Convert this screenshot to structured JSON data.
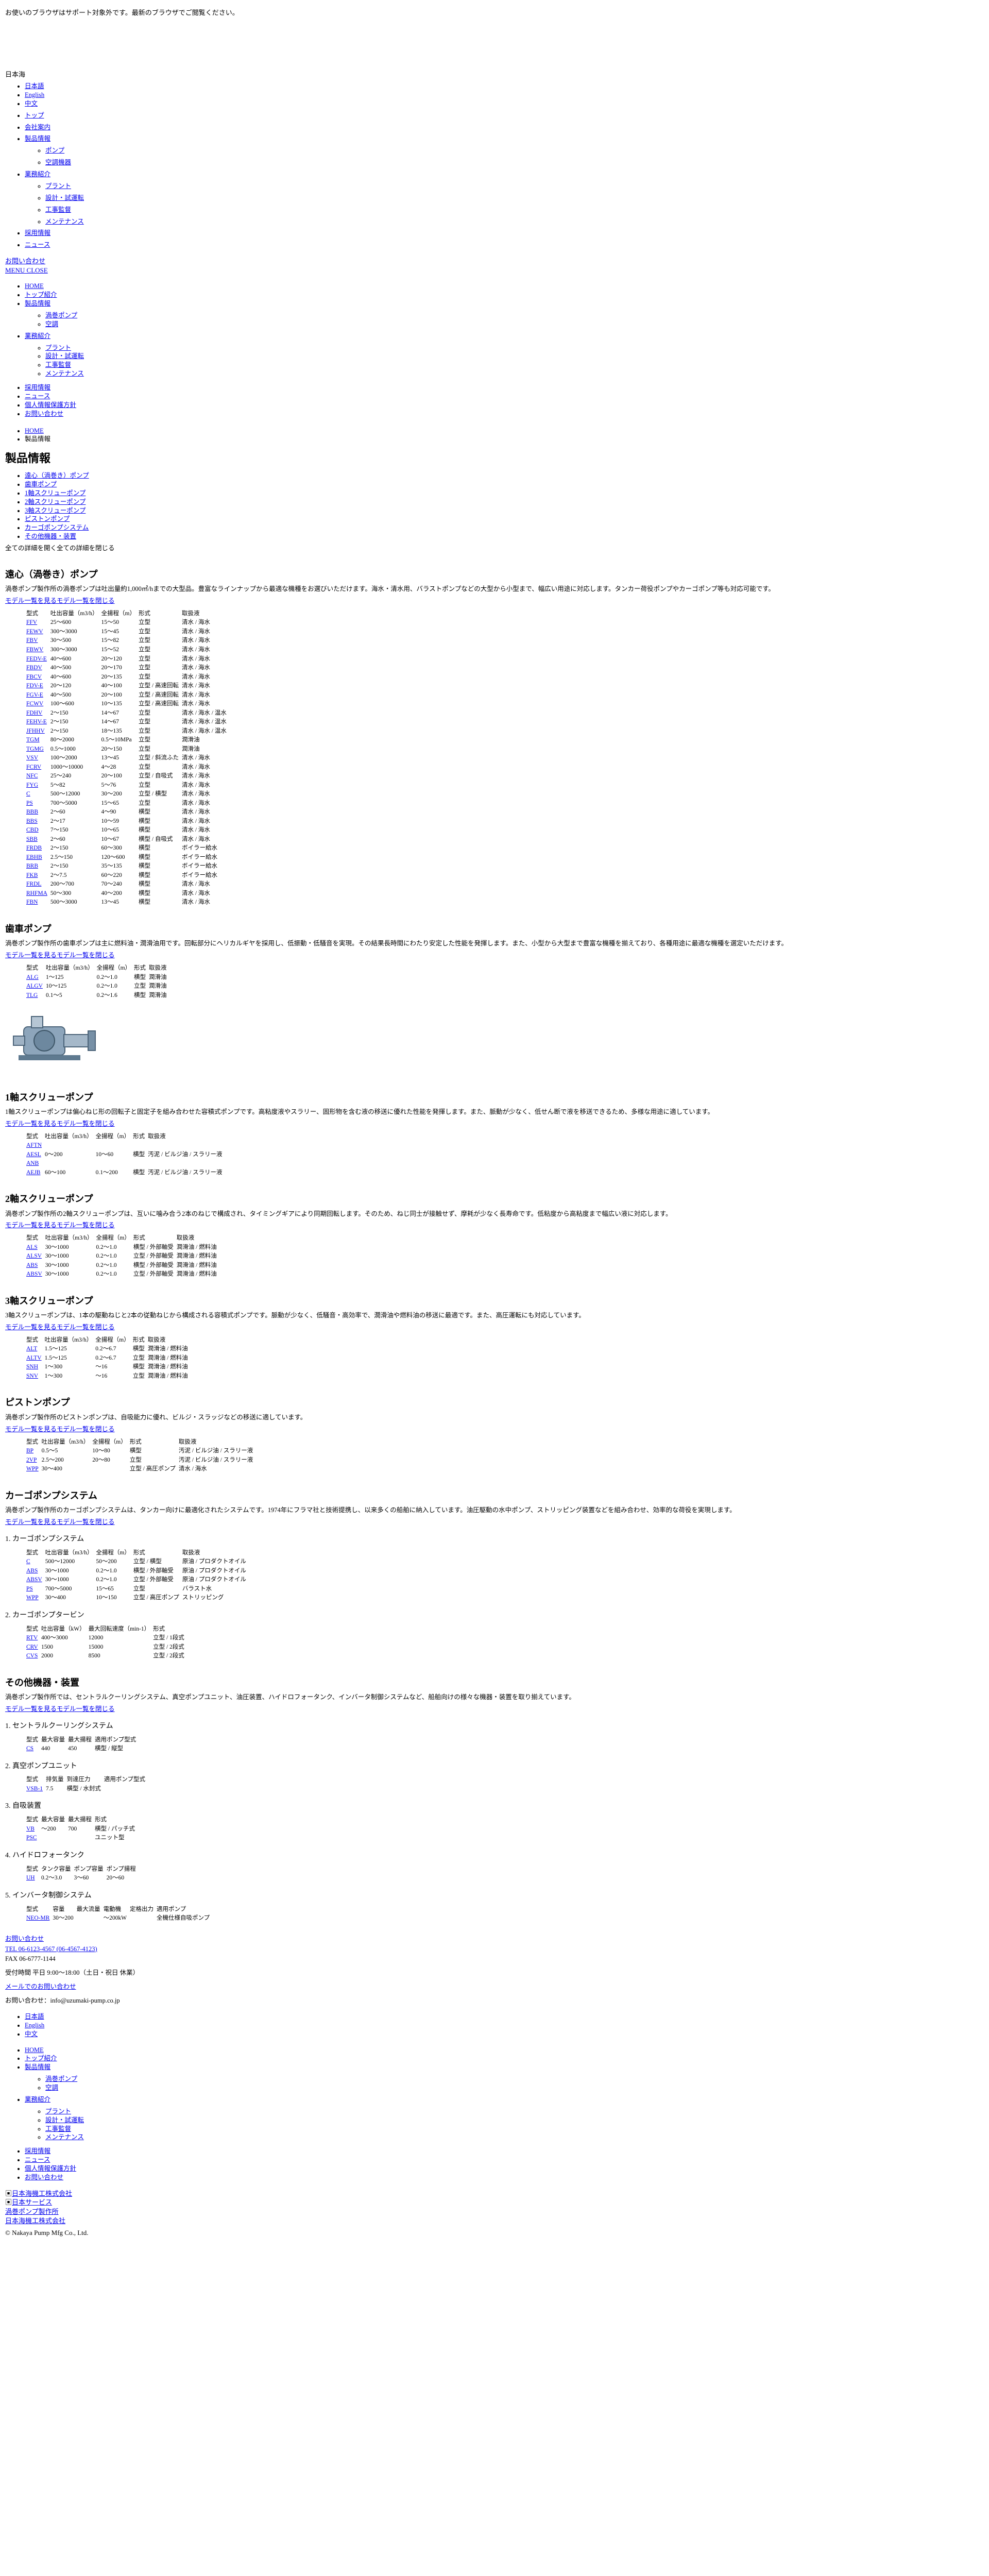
{
  "notice": "お使いのブラウザはサポート対象外です。最新のブラウザでご閲覧ください。",
  "logo": "日本海",
  "lang_links": [
    "日本語",
    "English",
    "中文"
  ],
  "main_nav": [
    "トップ",
    "会社案内",
    "製品情報"
  ],
  "products_sub1": [
    "ポンプ",
    "空調機器"
  ],
  "main_nav_more": "業務紹介",
  "works_sub": [
    "プラント",
    "設計・試運転",
    "工事監督",
    "メンテナンス"
  ],
  "main_nav_tail": [
    "採用情報",
    "ニュース"
  ],
  "contact_link": "お問い合わせ",
  "menu_close": "MENU CLOSE",
  "nav2": [
    "HOME",
    "トップ紹介",
    "製品情報"
  ],
  "nav2_products": [
    "渦巻ポンプ",
    "空調"
  ],
  "nav2_works": "業務紹介",
  "nav2_works_sub": [
    "プラント",
    "設計・試運転",
    "工事監督",
    "メンテナンス"
  ],
  "nav2_tail": [
    "採用情報",
    "ニュース",
    "個人情報保護方針",
    "お問い合わせ"
  ],
  "breadcrumb": [
    "HOME",
    "製品情報"
  ],
  "page_title": "製品情報",
  "anchors": [
    "遠心（渦巻き）ポンプ",
    "歯車ポンプ",
    "1軸スクリューポンプ",
    "2軸スクリューポンプ",
    "3軸スクリューポンプ",
    "ピストンポンプ",
    "カーゴポンプシステム",
    "その他機器・装置"
  ],
  "open_all": "全ての詳細を開く全ての詳細を閉じる",
  "model_link": "モデル一覧を見るモデル一覧を閉じる",
  "sections": {
    "centrifugal": {
      "title": "遠心（渦巻き）ポンプ",
      "desc": "渦巻ポンプ製作所の渦巻ポンプは吐出量約1,000㎥/hまでの大型品。豊富なラインナップから最適な機種をお選びいただけます。海水・清水用、バラストポンプなどの大型から小型まで、幅広い用途に対応します。タンカー荷役ポンプやカーゴポンプ等も対応可能です。",
      "headers": [
        "型式",
        "吐出容量（m3/h）",
        "全揚程（m）",
        "形式",
        "取扱液"
      ],
      "rows": [
        [
          "FFV",
          "25～600",
          "15～50",
          "立型",
          "清水 / 海水"
        ],
        [
          "FEWV",
          "300～3000",
          "15～45",
          "立型",
          "清水 / 海水"
        ],
        [
          "FBV",
          "30～500",
          "15～82",
          "立型",
          "清水 / 海水"
        ],
        [
          "FBWV",
          "300～3000",
          "15～52",
          "立型",
          "清水 / 海水"
        ],
        [
          "FEDV-E",
          "40～600",
          "20～120",
          "立型",
          "清水 / 海水"
        ],
        [
          "FBDV",
          "40～500",
          "20～170",
          "立型",
          "清水 / 海水"
        ],
        [
          "FBCV",
          "40～600",
          "20～135",
          "立型",
          "清水 / 海水"
        ],
        [
          "FDV-E",
          "20～120",
          "40～100",
          "立型 / 高速回転",
          "清水 / 海水"
        ],
        [
          "FGV-E",
          "40～500",
          "20～100",
          "立型 / 高速回転",
          "清水 / 海水"
        ],
        [
          "FCWV",
          "100～600",
          "10～135",
          "立型 / 高速回転",
          "清水 / 海水"
        ],
        [
          "FDHV",
          "2～150",
          "14～67",
          "立型",
          "清水 / 海水 / 温水"
        ],
        [
          "FEHV-E",
          "2～150",
          "14～67",
          "立型",
          "清水 / 海水 / 温水"
        ],
        [
          "JFHHV",
          "2～150",
          "18～135",
          "立型",
          "清水 / 海水 / 温水"
        ],
        [
          "TGM",
          "80～2000",
          "0.5～10MPa",
          "立型",
          "潤滑油"
        ],
        [
          "TGMG",
          "0.5～1000",
          "20～150",
          "立型",
          "潤滑油"
        ],
        [
          "VSV",
          "100～2000",
          "13～45",
          "立型 / 斜流ふた",
          "清水 / 海水"
        ],
        [
          "FCRV",
          "1000～10000",
          "4～28",
          "立型",
          "清水 / 海水"
        ],
        [
          "NFC",
          "25～240",
          "20～100",
          "立型 / 自吸式",
          "清水 / 海水"
        ],
        [
          "FYG",
          "5～82",
          "5～76",
          "立型",
          "清水 / 海水"
        ],
        [
          "C",
          "500～12000",
          "30～200",
          "立型 / 横型",
          "清水 / 海水"
        ],
        [
          "PS",
          "700～5000",
          "15～65",
          "立型",
          "清水 / 海水"
        ],
        [
          "BBB",
          "2～60",
          "4～90",
          "横型",
          "清水 / 海水"
        ],
        [
          "BBS",
          "2～17",
          "10～59",
          "横型",
          "清水 / 海水"
        ],
        [
          "CBD",
          "7～150",
          "10～65",
          "横型",
          "清水 / 海水"
        ],
        [
          "SBB",
          "2～60",
          "10～67",
          "横型 / 自吸式",
          "清水 / 海水"
        ],
        [
          "FRDB",
          "2～150",
          "60～300",
          "横型",
          "ボイラー給水"
        ],
        [
          "EBHB",
          "2.5～150",
          "120～600",
          "横型",
          "ボイラー給水"
        ],
        [
          "BRB",
          "2～150",
          "35～135",
          "横型",
          "ボイラー給水"
        ],
        [
          "FKB",
          "2～7.5",
          "60～220",
          "横型",
          "ボイラー給水"
        ],
        [
          "FRDL",
          "200～700",
          "70～240",
          "横型",
          "清水 / 海水"
        ],
        [
          "RHFMA",
          "50～300",
          "40～200",
          "横型",
          "清水 / 海水"
        ],
        [
          "FBN",
          "500～3000",
          "13～45",
          "横型",
          "清水 / 海水"
        ]
      ]
    },
    "gear": {
      "title": "歯車ポンプ",
      "desc": "渦巻ポンプ製作所の歯車ポンプは主に燃料油・潤滑油用です。回転部分にヘリカルギヤを採用し、低振動・低騒音を実現。その結果長時間にわたり安定した性能を発揮します。また、小型から大型まで豊富な機種を揃えており、各種用途に最適な機種を選定いただけます。",
      "headers": [
        "型式",
        "吐出容量（m3/h）",
        "全揚程（m）",
        "形式",
        "取扱液"
      ],
      "rows": [
        [
          "ALG",
          "1～125",
          "0.2～1.0",
          "横型",
          "潤滑油"
        ],
        [
          "ALGV",
          "10～125",
          "0.2～1.0",
          "立型",
          "潤滑油"
        ],
        [
          "TLG",
          "0.1～5",
          "0.2～1.6",
          "横型",
          "潤滑油"
        ]
      ]
    },
    "screw1": {
      "title": "1軸スクリューポンプ",
      "desc": "1軸スクリューポンプは偏心ねじ形の回転子と固定子を組み合わせた容積式ポンプです。高粘度液やスラリー、固形物を含む液の移送に優れた性能を発揮します。また、脈動が少なく、低せん断で液を移送できるため、多様な用途に適しています。",
      "headers": [
        "型式",
        "吐出容量（m3/h）",
        "全揚程（m）",
        "形式",
        "取扱液"
      ],
      "rows": [
        [
          "AFTN",
          "",
          "",
          "",
          ""
        ],
        [
          "AESL",
          "0～200",
          "10～60",
          "横型",
          "汚泥 / ビルジ油 / スラリー液"
        ],
        [
          "ANB",
          "",
          "",
          "",
          ""
        ],
        [
          "AEJB",
          "60～100",
          "0.1～200",
          "横型",
          "汚泥 / ビルジ油 / スラリー液"
        ]
      ]
    },
    "screw2": {
      "title": "2軸スクリューポンプ",
      "desc": "渦巻ポンプ製作所の2軸スクリューポンプは、互いに噛み合う2本のねじで構成され、タイミングギアにより同期回転します。そのため、ねじ同士が接触せず、摩耗が少なく長寿命です。低粘度から高粘度まで幅広い液に対応します。",
      "headers": [
        "型式",
        "吐出容量（m3/h）",
        "全揚程（m）",
        "形式",
        "取扱液"
      ],
      "rows": [
        [
          "ALS",
          "30～1000",
          "0.2～1.0",
          "横型 / 外部軸受",
          "潤滑油 / 燃料油"
        ],
        [
          "ALSV",
          "30～1000",
          "0.2～1.0",
          "立型 / 外部軸受",
          "潤滑油 / 燃料油"
        ],
        [
          "ABS",
          "30～1000",
          "0.2～1.0",
          "横型 / 外部軸受",
          "潤滑油 / 燃料油"
        ],
        [
          "ABSV",
          "30～1000",
          "0.2～1.0",
          "立型 / 外部軸受",
          "潤滑油 / 燃料油"
        ]
      ]
    },
    "screw3": {
      "title": "3軸スクリューポンプ",
      "desc": "3軸スクリューポンプは、1本の駆動ねじと2本の従動ねじから構成される容積式ポンプです。脈動が少なく、低騒音・高効率で、潤滑油や燃料油の移送に最適です。また、高圧運転にも対応しています。",
      "headers": [
        "型式",
        "吐出容量（m3/h）",
        "全揚程（m）",
        "形式",
        "取扱液"
      ],
      "rows": [
        [
          "ALT",
          "1.5～125",
          "0.2～6.7",
          "横型",
          "潤滑油 / 燃料油"
        ],
        [
          "ALTV",
          "1.5～125",
          "0.2～6.7",
          "立型",
          "潤滑油 / 燃料油"
        ],
        [
          "SNH",
          "1～300",
          "～16",
          "横型",
          "潤滑油 / 燃料油"
        ],
        [
          "SNV",
          "1～300",
          "～16",
          "立型",
          "潤滑油 / 燃料油"
        ]
      ]
    },
    "piston": {
      "title": "ピストンポンプ",
      "desc": "渦巻ポンプ製作所のピストンポンプは、自吸能力に優れ、ビルジ・スラッジなどの移送に適しています。",
      "headers": [
        "型式",
        "吐出容量（m3/h）",
        "全揚程（m）",
        "形式",
        "取扱液"
      ],
      "rows": [
        [
          "BP",
          "0.5～5",
          "10～80",
          "横型",
          "汚泥 / ビルジ油 / スラリー液"
        ],
        [
          "2VP",
          "2.5～200",
          "20～80",
          "立型",
          "汚泥 / ビルジ油 / スラリー液"
        ],
        [
          "WPP",
          "30～400",
          "",
          "立型 / 高圧ポンプ",
          "清水 / 海水"
        ]
      ]
    },
    "cargo": {
      "title": "カーゴポンプシステム",
      "desc": "渦巻ポンプ製作所のカーゴポンプシステムは、タンカー向けに最適化されたシステムです。1974年にフラマ社と技術提携し、以来多くの船舶に納入しています。油圧駆動の水中ポンプ、ストリッピング装置などを組み合わせ、効率的な荷役を実現します。",
      "sub1": "1. カーゴポンプシステム",
      "headers1": [
        "型式",
        "吐出容量（m3/h）",
        "全揚程（m）",
        "形式",
        "取扱液"
      ],
      "rows1": [
        [
          "C",
          "500～12000",
          "50～200",
          "立型 / 横型",
          "原油 / プロダクトオイル"
        ],
        [
          "ABS",
          "30～1000",
          "0.2～1.0",
          "横型 / 外部軸受",
          "原油 / プロダクトオイル"
        ],
        [
          "ABSV",
          "30～1000",
          "0.2～1.0",
          "立型 / 外部軸受",
          "原油 / プロダクトオイル"
        ],
        [
          "PS",
          "700～5000",
          "15～65",
          "立型",
          "バラスト水"
        ],
        [
          "WPP",
          "30～400",
          "10～150",
          "立型 / 高圧ポンプ",
          "ストリッピング"
        ]
      ],
      "sub2": "2. カーゴポンプタービン",
      "headers2": [
        "型式",
        "吐出容量（kW）",
        "最大回転速度（min-1）",
        "形式"
      ],
      "rows2": [
        [
          "RTV",
          "400～3000",
          "12000",
          "立型 / 1段式"
        ],
        [
          "CRV",
          "1500",
          "15000",
          "立型 / 2段式"
        ],
        [
          "CVS",
          "2000",
          "8500",
          "立型 / 2段式"
        ]
      ]
    },
    "other": {
      "title": "その他機器・装置",
      "desc": "渦巻ポンプ製作所では、セントラルクーリングシステム、真空ポンプユニット、油圧装置、ハイドロフォータンク、インバータ制御システムなど、船舶向けの様々な機器・装置を取り揃えています。",
      "subs": [
        {
          "title": "1. セントラルクーリングシステム",
          "headers": [
            "型式",
            "最大容量",
            "最大揚程",
            "適用ポンプ型式"
          ],
          "rows": [
            [
              "CS",
              "440",
              "450",
              "横型 / 縦型"
            ]
          ]
        },
        {
          "title": "2. 真空ポンプユニット",
          "headers": [
            "型式",
            "排気量",
            "到達圧力",
            "適用ポンプ型式"
          ],
          "rows": [
            [
              "VSB-1",
              "7.5",
              "横型 / 水封式",
              ""
            ]
          ]
        },
        {
          "title": "3. 自吸装置",
          "headers": [
            "型式",
            "最大容量",
            "最大揚程",
            "形式"
          ],
          "rows": [
            [
              "VB",
              "～200",
              "700",
              "横型 / パッチ式"
            ],
            [
              "PSC",
              "",
              "",
              "ユニット型"
            ]
          ]
        },
        {
          "title": "4. ハイドロフォータンク",
          "headers": [
            "型式",
            "タンク容量",
            "ポンプ容量",
            "ポンプ揚程"
          ],
          "rows": [
            [
              "UH",
              "0.2～3.0",
              "3～60",
              "20～60"
            ]
          ]
        },
        {
          "title": "5. インバータ制御システム",
          "headers": [
            "型式",
            "容量",
            "最大流量",
            "電動機",
            "定格出力",
            "適用ポンプ"
          ],
          "rows": [
            [
              "NEO-MR",
              "30～200",
              "",
              "～200kW",
              "",
              "全機仕様自吸ポンプ"
            ]
          ]
        }
      ]
    }
  },
  "footer": {
    "contact_title": "お問い合わせ",
    "tel": "TEL 06-6123-4567 (06-4567-4123)",
    "fax": "FAX 06-6777-1144",
    "hours": "受付時間 平日 9:00～18:00（土日・祝日 休業）",
    "mail_link": "メールでのお問い合わせ",
    "mail": "お問い合わせ：info@uzumaki-pump.co.jp",
    "lang_links": [
      "日本語",
      "English",
      "中文"
    ],
    "nav": [
      "HOME",
      "トップ紹介",
      "製品情報"
    ],
    "products_sub": [
      "渦巻ポンプ",
      "空調"
    ],
    "works": "業務紹介",
    "works_sub": [
      "プラント",
      "設計・試運転",
      "工事監督",
      "メンテナンス"
    ],
    "tail": [
      "採用情報",
      "ニュース",
      "個人情報保護方針",
      "お問い合わせ"
    ],
    "banner_links": [
      "日本海機工株式会社",
      "日本サービス",
      "渦巻ポンプ製作所",
      "日本海機工株式会社"
    ],
    "copyright": "© Nakaya Pump Mfg Co., Ltd."
  }
}
